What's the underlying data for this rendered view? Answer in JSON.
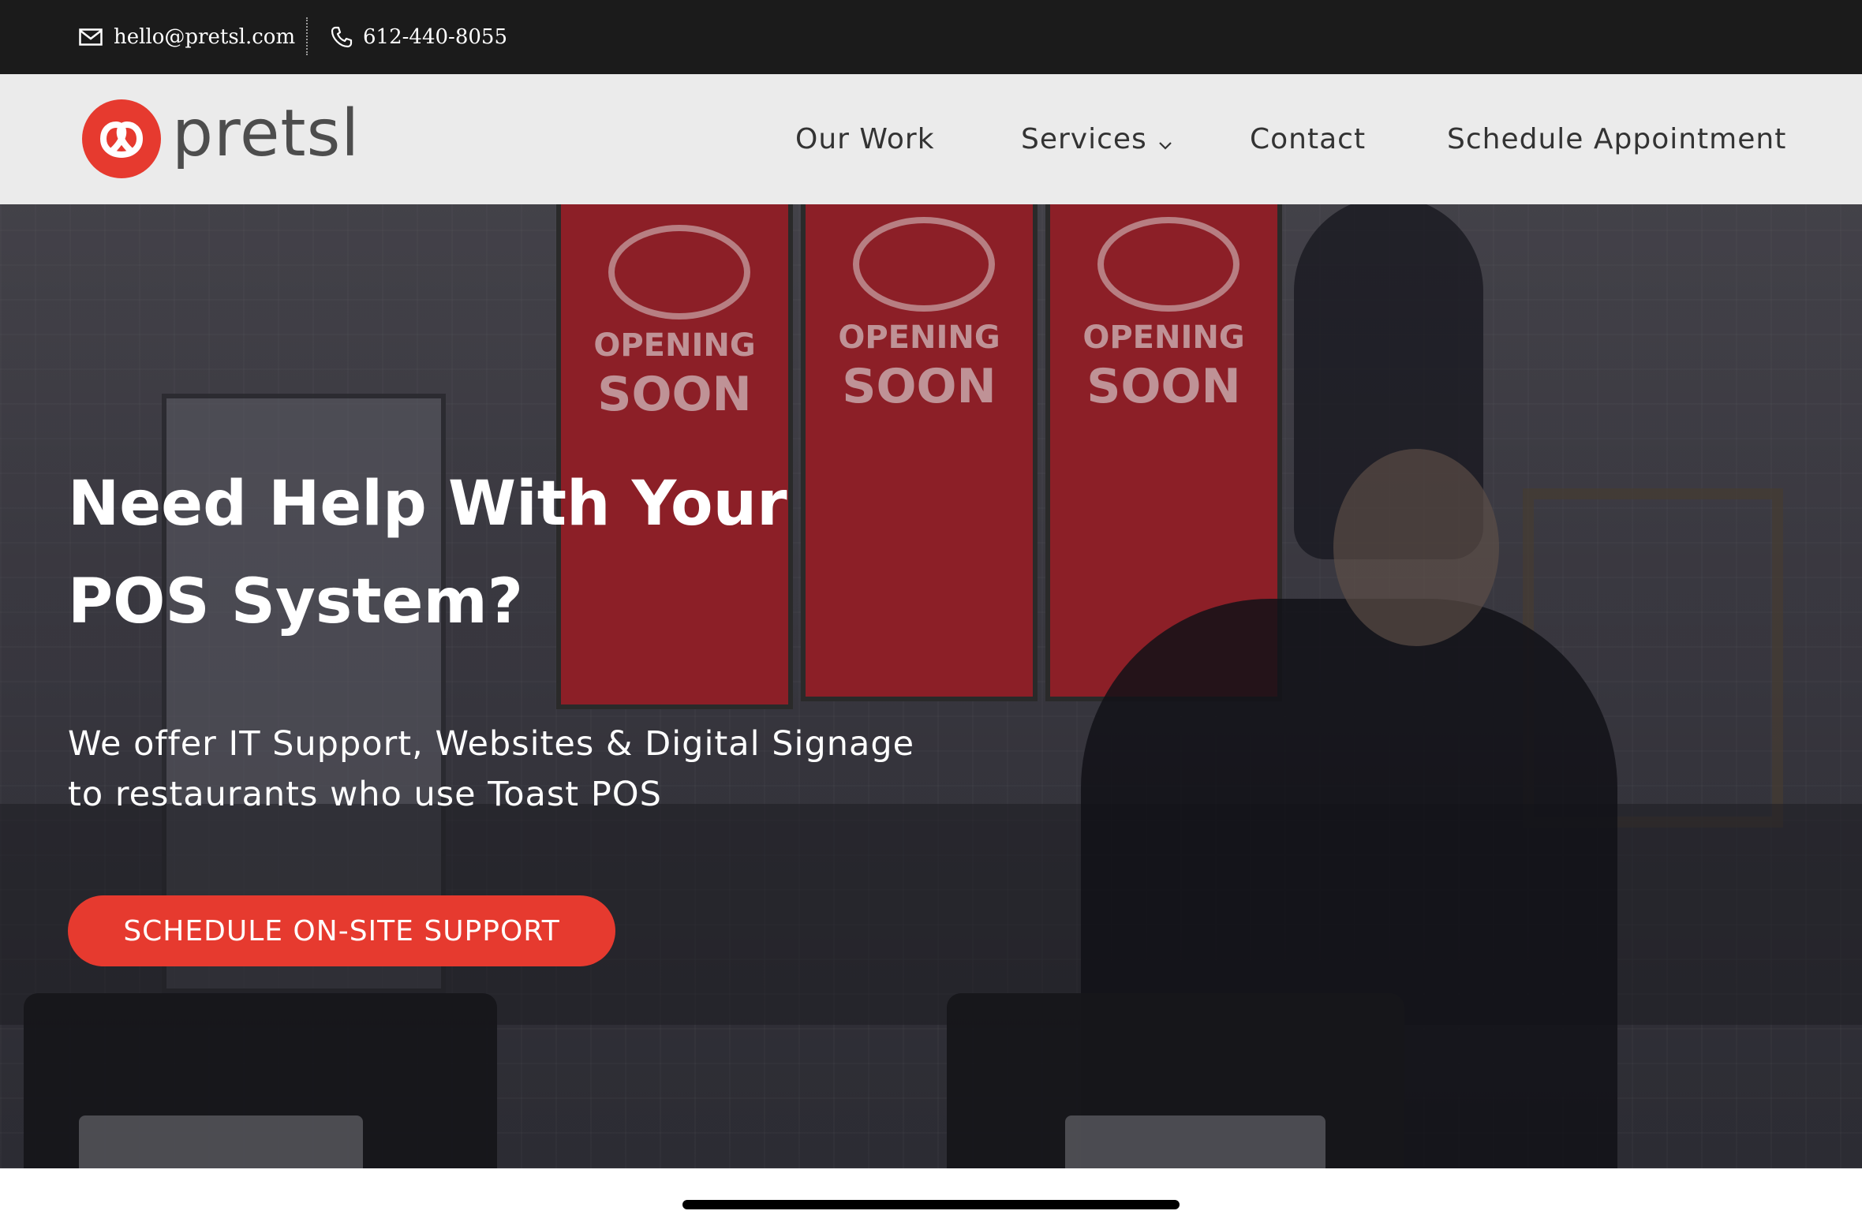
{
  "topbar": {
    "email": "hello@pretsl.com",
    "phone": "612-440-8055",
    "email_icon": "mail-icon",
    "phone_icon": "phone-icon"
  },
  "header": {
    "logo_text": "pretsl",
    "nav": {
      "our_work": "Our Work",
      "services": "Services",
      "contact": "Contact",
      "schedule": "Schedule Appointment"
    },
    "services_icon": "chevron-down-icon"
  },
  "hero": {
    "title_line1": "Need Help With Your",
    "title_line2": "POS System?",
    "subtitle_line1": "We offer IT Support, Websites & Digital Signage",
    "subtitle_line2": "to restaurants who use Toast POS",
    "cta_label": "SCHEDULE ON-SITE SUPPORT",
    "background_signs": [
      {
        "line1": "OPENING",
        "line2": "SOON"
      },
      {
        "line1": "OPENING",
        "line2": "SOON"
      },
      {
        "line1": "OPENING",
        "line2": "SOON"
      }
    ]
  },
  "colors": {
    "brand_red": "#e63a2f",
    "topbar_bg": "#1b1b1b",
    "header_bg": "#ebebeb",
    "nav_text": "#333333"
  }
}
